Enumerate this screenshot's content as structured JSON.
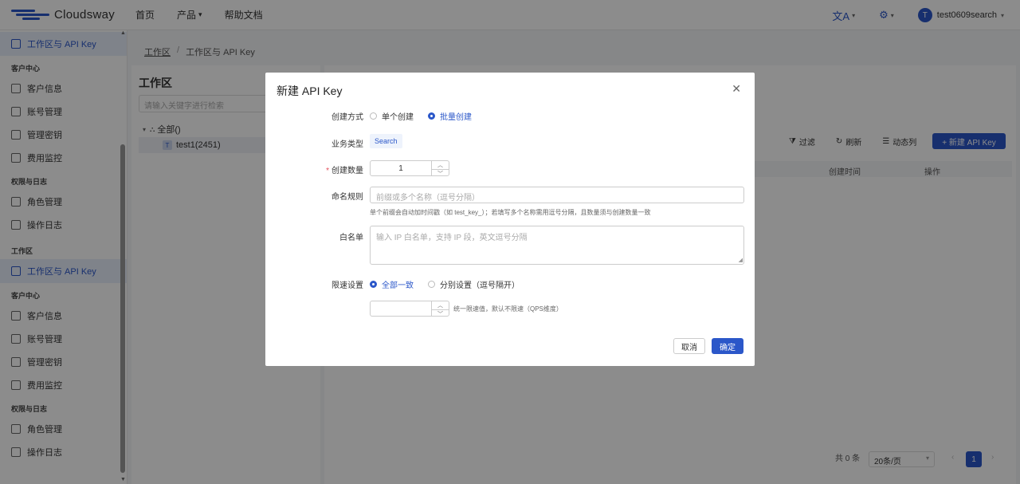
{
  "brand": {
    "name": "Cloudsway",
    "color": "#2b57c9"
  },
  "nav": {
    "items": [
      "首页",
      "产品",
      "帮助文档"
    ]
  },
  "topbar": {
    "translate_icon": "translate-icon",
    "settings_icon": "gear-icon",
    "avatar_letter": "T",
    "user_name": "test0609search"
  },
  "sidebar": {
    "active_top": "工作区与 API Key",
    "group1": "客户中心",
    "items1": [
      "客户信息",
      "账号管理",
      "管理密钥",
      "费用监控"
    ],
    "group2": "权限与日志",
    "items2": [
      "角色管理",
      "操作日志"
    ],
    "group3": "工作区",
    "active_mid": "工作区与 API Key",
    "group4": "客户中心",
    "items4": [
      "客户信息",
      "账号管理",
      "管理密钥",
      "费用监控"
    ],
    "group5": "权限与日志",
    "items5": [
      "角色管理",
      "操作日志"
    ]
  },
  "breadcrumb": {
    "root": "工作区",
    "current": "工作区与 API Key"
  },
  "left_panel": {
    "title": "工作区",
    "search_placeholder": "请输入关键字进行检索",
    "tree_root": "全部()",
    "tree_child_badge": "T",
    "tree_child": "test1(2451)"
  },
  "toolbar": {
    "filter": "过滤",
    "refresh": "刷新",
    "columns": "动态列",
    "new_key": "+ 新建 API Key"
  },
  "table": {
    "headers": [
      "创建时间",
      "操作"
    ]
  },
  "pagination": {
    "total": "共 0 条",
    "page_size": "20条/页",
    "current_page": "1"
  },
  "modal": {
    "title": "新建 API Key",
    "create_mode_label": "创建方式",
    "create_mode_options": [
      "单个创建",
      "批量创建"
    ],
    "create_mode_selected": "批量创建",
    "biz_type_label": "业务类型",
    "biz_type_value": "Search",
    "count_label": "创建数量",
    "count_value": "1",
    "naming_label": "命名规则",
    "naming_placeholder": "前缀或多个名称（逗号分隔）",
    "naming_hint": "单个前缀会自动加时间戳（如 test_key_）；若填写多个名称需用逗号分隔，且数量须与创建数量一致",
    "whitelist_label": "白名单",
    "whitelist_placeholder": "输入 IP 白名单，支持 IP 段，英文逗号分隔",
    "rate_label": "限速设置",
    "rate_options": [
      "全部一致",
      "分别设置（逗号隔开）"
    ],
    "rate_selected": "全部一致",
    "rate_value": "",
    "rate_hint": "统一限速值，默认不限速（QPS维度）",
    "cancel_label": "取消",
    "ok_label": "确定"
  }
}
